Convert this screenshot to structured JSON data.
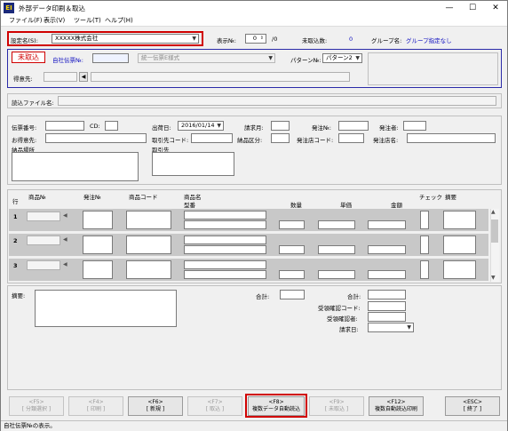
{
  "window": {
    "title": "外部データ印刷＆取込",
    "app_icon_text": "EI",
    "controls": {
      "minimize": "—",
      "maximize": "☐",
      "close": "✕"
    }
  },
  "menu": [
    "ファイル(F)",
    "表示(V)",
    "ツール(T)",
    "ヘルプ(H)"
  ],
  "header": {
    "setting_label": "設定名(S):",
    "setting_value": "XXXXX株式会社",
    "display_no_label": "表示№:",
    "display_no_value": "0",
    "display_total": "/0",
    "unread_label": "未取込数:",
    "unread_value": "0",
    "group_label": "グループ名:",
    "group_value": "グループ指定なし"
  },
  "status_block": {
    "status_badge": "未取込",
    "company_slip_label": "自社伝票№:",
    "company_slip_value": "",
    "format_select": "統一伝票E様式",
    "pattern_label": "パターン№:",
    "pattern_value": "パターン2",
    "customer_label": "得意先:",
    "customer_code": "",
    "customer_name": ""
  },
  "read_file": {
    "label": "読込ファイル名:",
    "value": ""
  },
  "slip": {
    "slip_no_label": "伝票番号:",
    "cd_label": "CD:",
    "ship_date_label": "出荷日:",
    "ship_date_value": "2016/01/14",
    "billing_month_label": "請求月:",
    "order_no_label": "発注№:",
    "orderer_label": "発注者:",
    "customer_label": "お得意先:",
    "trade_code_label": "取引先コード:",
    "delivery_class_label": "納品区分:",
    "order_shop_code_label": "発注店コード:",
    "order_shop_name_label": "発注店名:",
    "delivery_place_label": "納品場所",
    "trade_partner_label": "取引先"
  },
  "table": {
    "headers": {
      "row": "行",
      "product_no": "商品№",
      "order_no": "発注№",
      "product_code": "商品コード",
      "product_name": "商品名",
      "model": "型番",
      "quantity": "数量",
      "unit_price": "単価",
      "amount": "金額",
      "check": "チェック",
      "remarks": "摘要"
    },
    "rows": [
      "1",
      "2",
      "3"
    ]
  },
  "footer": {
    "remarks_label": "摘要:",
    "total_label_1": "合計:",
    "total_label_2": "合計:",
    "receive_code_label": "受領確認コード:",
    "receive_person_label": "受領確認者:",
    "billing_date_label": "請求日:"
  },
  "buttons": [
    {
      "key": "<F5>",
      "label": "[ 分類選択 ]",
      "enabled": false
    },
    {
      "key": "<F4>",
      "label": "[ 印刷 ]",
      "enabled": false
    },
    {
      "key": "<F6>",
      "label": "[ 新規 ]",
      "enabled": true
    },
    {
      "key": "<F7>",
      "label": "[ 取込 ]",
      "enabled": false
    },
    {
      "key": "<F8>",
      "label": "複数データ自動読込",
      "enabled": true
    },
    {
      "key": "<F9>",
      "label": "[ 未取込 ]",
      "enabled": false
    },
    {
      "key": "<F12>",
      "label": "複数自動読込印刷",
      "enabled": true
    },
    {
      "key": "<ESC>",
      "label": "[ 終了 ]",
      "enabled": true
    }
  ],
  "status_bar": "自社伝票№の表示。",
  "colors": {
    "highlight": "#d00000",
    "panel_border": "#2a2aa8",
    "label_blue": "#1010c0"
  }
}
